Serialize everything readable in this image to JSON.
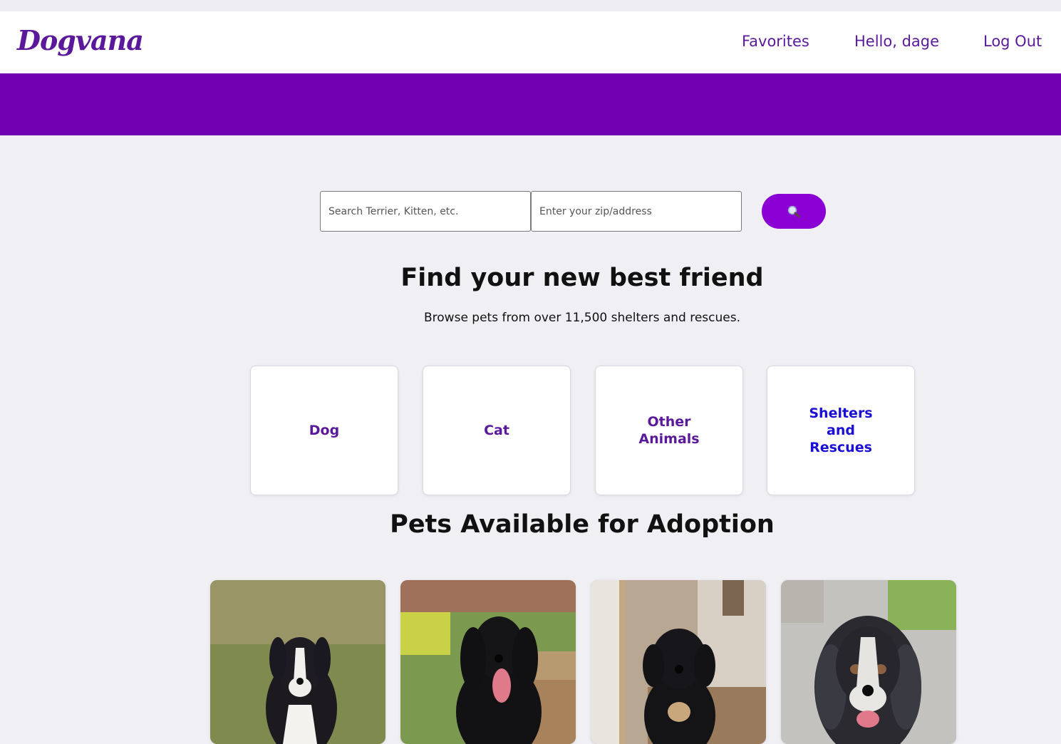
{
  "header": {
    "logo": "Dogvana",
    "nav": {
      "favorites": "Favorites",
      "greeting": "Hello, dage",
      "logout": "Log Out"
    }
  },
  "search": {
    "pet_placeholder": "Search Terrier, Kitten, etc.",
    "location_placeholder": "Enter your zip/address",
    "button_icon": "search-icon"
  },
  "hero": {
    "title": "Find your new best friend",
    "subtitle": "Browse pets from over 11,500 shelters and rescues."
  },
  "categories": [
    {
      "label": "Dog"
    },
    {
      "label": "Cat"
    },
    {
      "label": "Other Animals"
    },
    {
      "label": "Shelters and Rescues"
    }
  ],
  "pets_section": {
    "title": "Pets Available for Adoption"
  },
  "colors": {
    "brand": "#5a189a",
    "banner": "#7000b2",
    "search_button": "#8a00d4",
    "shelters_link": "#1a0fd6",
    "page_background": "#efeff4"
  }
}
